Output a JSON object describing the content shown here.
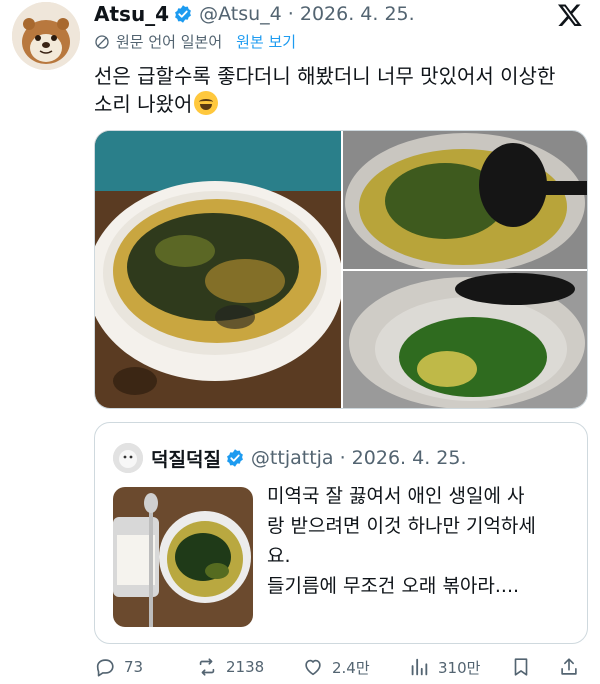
{
  "author": {
    "display_name": "Atsu_4",
    "handle_date": "@Atsu_4 · 2026. 4. 25."
  },
  "translation": {
    "label": "원문 언어 일본어",
    "show_original": "원본 보기"
  },
  "tweet": {
    "line1": "선은 급할수록 좋다더니 해봤더니 너무 맛있어서 이상한",
    "line2": "소리 나왔어"
  },
  "quote": {
    "display_name": "덕질덕질",
    "handle_date": "@ttjattja · 2026. 4. 25.",
    "line1": "미역국 잘 끓여서 애인 생일에 사",
    "line2": "랑 받으려면 이것 하나만 기억하세",
    "line3": "요.",
    "line4": "들기름에 무조건 오래 볶아라...."
  },
  "actions": {
    "replies": "73",
    "reposts": "2138",
    "likes": "2.4만",
    "views": "310만"
  },
  "colors": {
    "verified": "#1d9bf0",
    "link": "#1d9bf0",
    "secondary_text": "#536471"
  }
}
